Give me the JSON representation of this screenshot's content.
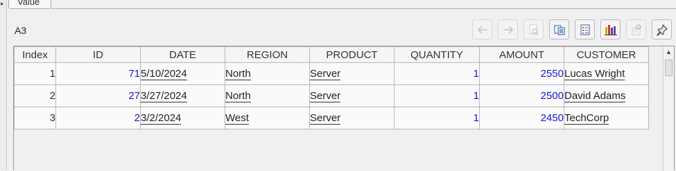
{
  "tab": {
    "label": "Value"
  },
  "cell_ref": "A3",
  "toolbar": {
    "buttons": [
      {
        "icon": "arrow-left-icon",
        "enabled": false
      },
      {
        "icon": "arrow-right-icon",
        "enabled": false
      },
      {
        "icon": "document-search-icon",
        "enabled": false
      },
      {
        "icon": "copy-icon",
        "enabled": true
      },
      {
        "icon": "list-icon",
        "enabled": true
      },
      {
        "icon": "bar-chart-icon",
        "enabled": true
      },
      {
        "icon": "settings-icon",
        "enabled": false
      },
      {
        "icon": "pin-icon",
        "enabled": true
      }
    ]
  },
  "grid": {
    "columns": [
      "Index",
      "ID",
      "DATE",
      "REGION",
      "PRODUCT",
      "QUANTITY",
      "AMOUNT",
      "CUSTOMER"
    ],
    "rows": [
      {
        "index": "1",
        "id": "71",
        "date": "5/10/2024",
        "region": "North",
        "product": "Server",
        "quantity": "1",
        "amount": "2550",
        "customer": "Lucas Wright"
      },
      {
        "index": "2",
        "id": "27",
        "date": "3/27/2024",
        "region": "North",
        "product": "Server",
        "quantity": "1",
        "amount": "2500",
        "customer": "David Adams"
      },
      {
        "index": "3",
        "id": "2",
        "date": "3/2/2024",
        "region": "West",
        "product": "Server",
        "quantity": "1",
        "amount": "2450",
        "customer": "TechCorp"
      }
    ]
  },
  "colors": {
    "number_text": "#1a1acd",
    "grid_border": "#b7b7b7",
    "background": "#f0f0f0"
  }
}
